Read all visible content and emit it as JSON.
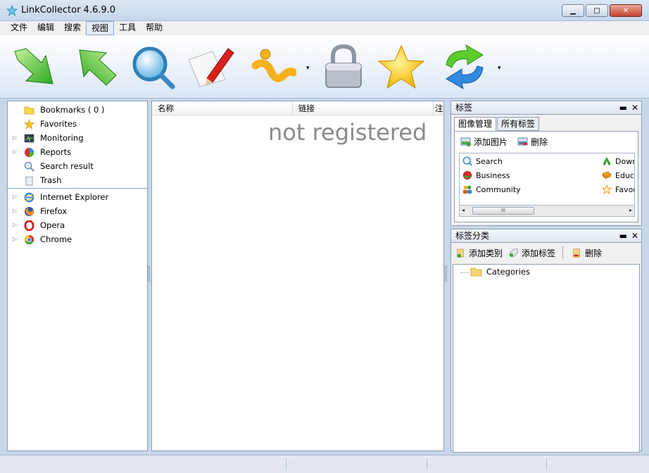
{
  "window": {
    "title": "LinkCollector 4.6.9.0",
    "icon": "star-app-icon"
  },
  "menu": [
    "文件",
    "编辑",
    "搜索",
    "视图",
    "工具",
    "帮助"
  ],
  "toolbar": {
    "buttons": [
      {
        "name": "import",
        "icon": "green-arrow-down-icon"
      },
      {
        "name": "export",
        "icon": "green-arrow-up-icon"
      },
      {
        "name": "search",
        "icon": "magnifier-icon"
      },
      {
        "name": "edit",
        "icon": "pen-paper-icon"
      },
      {
        "name": "info",
        "icon": "info-icon",
        "has_dropdown": true
      },
      {
        "name": "lock",
        "icon": "padlock-icon"
      },
      {
        "name": "favorite",
        "icon": "star-icon"
      },
      {
        "name": "sync",
        "icon": "refresh-icon",
        "has_dropdown": true
      }
    ],
    "dropdown_glyph": "▾"
  },
  "left_tree": {
    "group1": [
      {
        "label": "Bookmarks ( 0 )",
        "icon": "folder-icon",
        "expandable": false
      },
      {
        "label": "Favorites",
        "icon": "star-icon",
        "expandable": false
      },
      {
        "label": "Monitoring",
        "icon": "monitor-icon",
        "expandable": true
      },
      {
        "label": "Reports",
        "icon": "pie-chart-icon",
        "expandable": true
      },
      {
        "label": "Search result",
        "icon": "magnifier-icon",
        "expandable": false
      },
      {
        "label": "Trash",
        "icon": "trash-icon",
        "expandable": false
      }
    ],
    "group2": [
      {
        "label": "Internet Explorer",
        "icon": "ie-icon",
        "expandable": true
      },
      {
        "label": "Firefox",
        "icon": "firefox-icon",
        "expandable": true
      },
      {
        "label": "Opera",
        "icon": "opera-icon",
        "expandable": true
      },
      {
        "label": "Chrome",
        "icon": "chrome-icon",
        "expandable": true
      }
    ]
  },
  "center": {
    "columns": [
      "名称",
      "链接",
      "注"
    ],
    "overlay_text": "not registered"
  },
  "tags_pane": {
    "title": "标签",
    "pin": "▬",
    "close": "✕",
    "tabs": [
      "图像管理",
      "所有标签"
    ],
    "actions": [
      "添加图片",
      "删除"
    ],
    "tags_left": [
      {
        "label": "Search",
        "icon": "magnifier-icon"
      },
      {
        "label": "Business",
        "icon": "red-circle-icon"
      },
      {
        "label": "Community",
        "icon": "people-icon"
      }
    ],
    "tags_right": [
      {
        "label": "Down",
        "icon": "green-arrows-icon"
      },
      {
        "label": "Educa",
        "icon": "book-icon"
      },
      {
        "label": "Favor",
        "icon": "star-outline-icon"
      }
    ],
    "scroll_thumb_text": "III"
  },
  "categories_pane": {
    "title": "标签分类",
    "pin": "▬",
    "close": "✕",
    "actions": [
      "添加类别",
      "添加标签",
      "删除"
    ],
    "root": "Categories"
  }
}
